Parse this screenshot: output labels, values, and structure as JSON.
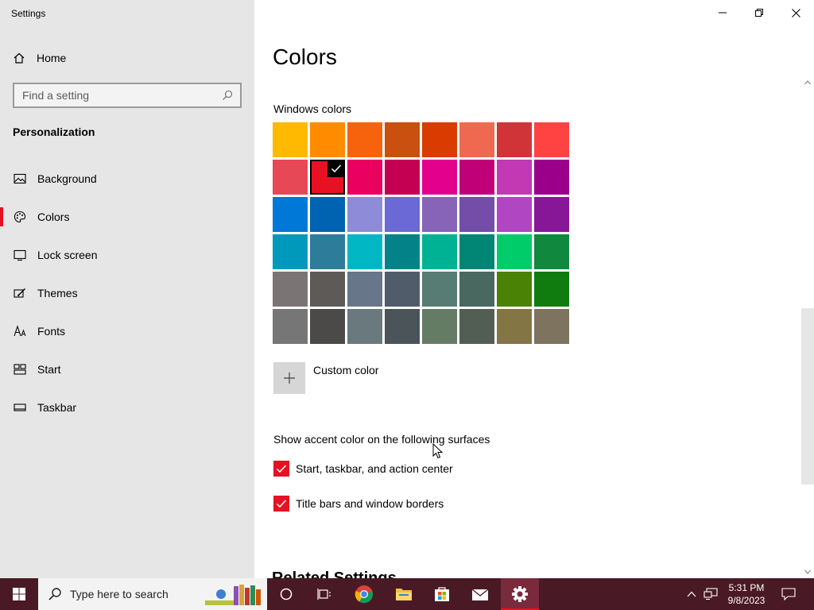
{
  "window": {
    "title": "Settings"
  },
  "sidebar": {
    "home_label": "Home",
    "search_placeholder": "Find a setting",
    "section_title": "Personalization",
    "items": [
      {
        "label": "Background",
        "icon": "image-icon",
        "active": false
      },
      {
        "label": "Colors",
        "icon": "palette-icon",
        "active": true
      },
      {
        "label": "Lock screen",
        "icon": "lock-screen-icon",
        "active": false
      },
      {
        "label": "Themes",
        "icon": "themes-icon",
        "active": false
      },
      {
        "label": "Fonts",
        "icon": "fonts-icon",
        "active": false
      },
      {
        "label": "Start",
        "icon": "start-icon",
        "active": false
      },
      {
        "label": "Taskbar",
        "icon": "taskbar-icon",
        "active": false
      }
    ]
  },
  "main": {
    "title": "Colors",
    "windows_colors_label": "Windows colors",
    "swatches": [
      "#FFB900",
      "#FF8C00",
      "#F7630C",
      "#CA5010",
      "#DA3B01",
      "#EF6950",
      "#D13438",
      "#FF4343",
      "#E74856",
      "#E81123",
      "#EA005E",
      "#C30052",
      "#E3008C",
      "#BF0077",
      "#C239B3",
      "#9A0089",
      "#0078D7",
      "#0063B1",
      "#8E8CD8",
      "#6B69D6",
      "#8764B8",
      "#744DA9",
      "#B146C2",
      "#881798",
      "#0099BC",
      "#2D7D9A",
      "#00B7C3",
      "#038387",
      "#00B294",
      "#018574",
      "#00CC6A",
      "#10893E",
      "#7A7574",
      "#5D5A58",
      "#68768A",
      "#515C6B",
      "#567C73",
      "#486860",
      "#498205",
      "#107C10",
      "#767676",
      "#4C4A48",
      "#69797E",
      "#4A5459",
      "#647C64",
      "#525E54",
      "#847545",
      "#7E735F"
    ],
    "selected_swatch_index": 9,
    "accent_color": "#E81123",
    "custom_color_label": "Custom color",
    "surfaces_label": "Show accent color on the following surfaces",
    "checkboxes": [
      {
        "label": "Start, taskbar, and action center",
        "checked": true
      },
      {
        "label": "Title bars and window borders",
        "checked": true
      }
    ],
    "related_settings_label": "Related Settings"
  },
  "taskbar": {
    "search_placeholder": "Type here to search",
    "time": "5:31 PM",
    "date": "9/8/2023"
  }
}
